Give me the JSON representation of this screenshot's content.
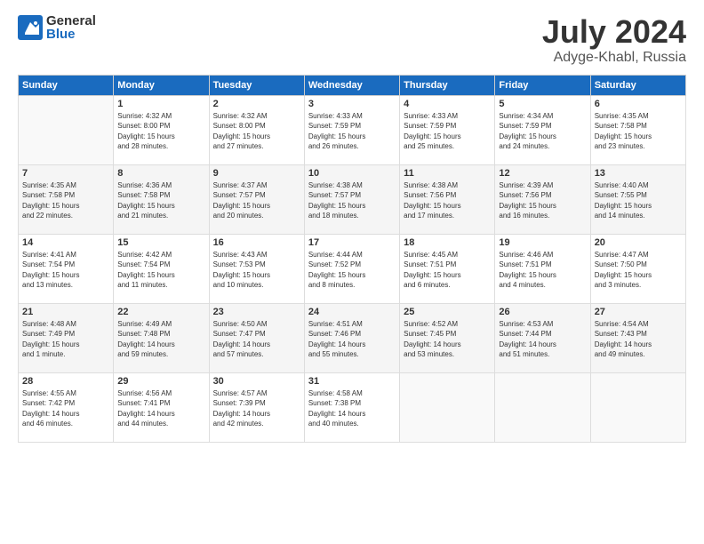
{
  "header": {
    "logo_general": "General",
    "logo_blue": "Blue",
    "month": "July 2024",
    "location": "Adyge-Khabl, Russia"
  },
  "days_of_week": [
    "Sunday",
    "Monday",
    "Tuesday",
    "Wednesday",
    "Thursday",
    "Friday",
    "Saturday"
  ],
  "weeks": [
    [
      {
        "day": "",
        "info": ""
      },
      {
        "day": "1",
        "info": "Sunrise: 4:32 AM\nSunset: 8:00 PM\nDaylight: 15 hours\nand 28 minutes."
      },
      {
        "day": "2",
        "info": "Sunrise: 4:32 AM\nSunset: 8:00 PM\nDaylight: 15 hours\nand 27 minutes."
      },
      {
        "day": "3",
        "info": "Sunrise: 4:33 AM\nSunset: 7:59 PM\nDaylight: 15 hours\nand 26 minutes."
      },
      {
        "day": "4",
        "info": "Sunrise: 4:33 AM\nSunset: 7:59 PM\nDaylight: 15 hours\nand 25 minutes."
      },
      {
        "day": "5",
        "info": "Sunrise: 4:34 AM\nSunset: 7:59 PM\nDaylight: 15 hours\nand 24 minutes."
      },
      {
        "day": "6",
        "info": "Sunrise: 4:35 AM\nSunset: 7:58 PM\nDaylight: 15 hours\nand 23 minutes."
      }
    ],
    [
      {
        "day": "7",
        "info": "Sunrise: 4:35 AM\nSunset: 7:58 PM\nDaylight: 15 hours\nand 22 minutes."
      },
      {
        "day": "8",
        "info": "Sunrise: 4:36 AM\nSunset: 7:58 PM\nDaylight: 15 hours\nand 21 minutes."
      },
      {
        "day": "9",
        "info": "Sunrise: 4:37 AM\nSunset: 7:57 PM\nDaylight: 15 hours\nand 20 minutes."
      },
      {
        "day": "10",
        "info": "Sunrise: 4:38 AM\nSunset: 7:57 PM\nDaylight: 15 hours\nand 18 minutes."
      },
      {
        "day": "11",
        "info": "Sunrise: 4:38 AM\nSunset: 7:56 PM\nDaylight: 15 hours\nand 17 minutes."
      },
      {
        "day": "12",
        "info": "Sunrise: 4:39 AM\nSunset: 7:56 PM\nDaylight: 15 hours\nand 16 minutes."
      },
      {
        "day": "13",
        "info": "Sunrise: 4:40 AM\nSunset: 7:55 PM\nDaylight: 15 hours\nand 14 minutes."
      }
    ],
    [
      {
        "day": "14",
        "info": "Sunrise: 4:41 AM\nSunset: 7:54 PM\nDaylight: 15 hours\nand 13 minutes."
      },
      {
        "day": "15",
        "info": "Sunrise: 4:42 AM\nSunset: 7:54 PM\nDaylight: 15 hours\nand 11 minutes."
      },
      {
        "day": "16",
        "info": "Sunrise: 4:43 AM\nSunset: 7:53 PM\nDaylight: 15 hours\nand 10 minutes."
      },
      {
        "day": "17",
        "info": "Sunrise: 4:44 AM\nSunset: 7:52 PM\nDaylight: 15 hours\nand 8 minutes."
      },
      {
        "day": "18",
        "info": "Sunrise: 4:45 AM\nSunset: 7:51 PM\nDaylight: 15 hours\nand 6 minutes."
      },
      {
        "day": "19",
        "info": "Sunrise: 4:46 AM\nSunset: 7:51 PM\nDaylight: 15 hours\nand 4 minutes."
      },
      {
        "day": "20",
        "info": "Sunrise: 4:47 AM\nSunset: 7:50 PM\nDaylight: 15 hours\nand 3 minutes."
      }
    ],
    [
      {
        "day": "21",
        "info": "Sunrise: 4:48 AM\nSunset: 7:49 PM\nDaylight: 15 hours\nand 1 minute."
      },
      {
        "day": "22",
        "info": "Sunrise: 4:49 AM\nSunset: 7:48 PM\nDaylight: 14 hours\nand 59 minutes."
      },
      {
        "day": "23",
        "info": "Sunrise: 4:50 AM\nSunset: 7:47 PM\nDaylight: 14 hours\nand 57 minutes."
      },
      {
        "day": "24",
        "info": "Sunrise: 4:51 AM\nSunset: 7:46 PM\nDaylight: 14 hours\nand 55 minutes."
      },
      {
        "day": "25",
        "info": "Sunrise: 4:52 AM\nSunset: 7:45 PM\nDaylight: 14 hours\nand 53 minutes."
      },
      {
        "day": "26",
        "info": "Sunrise: 4:53 AM\nSunset: 7:44 PM\nDaylight: 14 hours\nand 51 minutes."
      },
      {
        "day": "27",
        "info": "Sunrise: 4:54 AM\nSunset: 7:43 PM\nDaylight: 14 hours\nand 49 minutes."
      }
    ],
    [
      {
        "day": "28",
        "info": "Sunrise: 4:55 AM\nSunset: 7:42 PM\nDaylight: 14 hours\nand 46 minutes."
      },
      {
        "day": "29",
        "info": "Sunrise: 4:56 AM\nSunset: 7:41 PM\nDaylight: 14 hours\nand 44 minutes."
      },
      {
        "day": "30",
        "info": "Sunrise: 4:57 AM\nSunset: 7:39 PM\nDaylight: 14 hours\nand 42 minutes."
      },
      {
        "day": "31",
        "info": "Sunrise: 4:58 AM\nSunset: 7:38 PM\nDaylight: 14 hours\nand 40 minutes."
      },
      {
        "day": "",
        "info": ""
      },
      {
        "day": "",
        "info": ""
      },
      {
        "day": "",
        "info": ""
      }
    ]
  ]
}
